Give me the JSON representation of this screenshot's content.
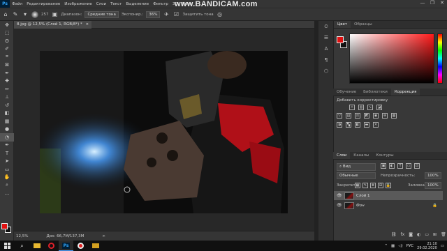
{
  "menubar": {
    "app_icon": "Ps",
    "items": [
      "Файл",
      "Редактирование",
      "Изображение",
      "Слои",
      "Текст",
      "Выделение",
      "Фильтр",
      "3D",
      "Прос"
    ]
  },
  "watermark": "www.BANDICAM.com",
  "window_controls": [
    "—",
    "❐",
    "✕"
  ],
  "options": {
    "brush_size": "257",
    "range_label": "Диапазон:",
    "range_value": "Средние тона",
    "exposure_label": "Экспонир.:",
    "exposure_value": "36%",
    "protect_label": "Защитить тона"
  },
  "document_tab": {
    "title": "8.jpg @ 12,5% (Слой 1, RGB/8*) *",
    "close": "×"
  },
  "statusbar": {
    "zoom": "12,5%",
    "doc": "Док: 66,7М/137,3М",
    "arrow": ">"
  },
  "color_panel": {
    "tabs": [
      "Цвет",
      "Образцы"
    ],
    "fg": "#e01010",
    "bg": "#111111"
  },
  "learn_panel": {
    "tabs": [
      "Обучение",
      "Библиотеки",
      "Коррекция"
    ],
    "add_label": "Добавить корректировку",
    "icons_row1": [
      "brightness-icon",
      "levels-icon",
      "curves-icon",
      "exposure-icon"
    ],
    "icons_row2": [
      "vibrance-icon",
      "hue-icon",
      "balance-icon",
      "bw-icon",
      "photofilter-icon",
      "mixer-icon",
      "lookup-icon"
    ],
    "icons_row3": [
      "invert-icon",
      "posterize-icon",
      "threshold-icon",
      "gradientmap-icon",
      "selectivecolor-icon"
    ]
  },
  "layers_panel": {
    "tabs": [
      "Слои",
      "Каналы",
      "Контуры"
    ],
    "filter_value": "Вид",
    "blend_mode": "Обычные",
    "opacity_label": "Непрозрачность:",
    "opacity_value": "100%",
    "lock_label": "Закрепить:",
    "fill_label": "Заливка:",
    "fill_value": "100%",
    "layers": [
      {
        "name": "Слой 1",
        "visible": true,
        "selected": true
      },
      {
        "name": "Фон",
        "visible": true,
        "selected": false
      }
    ]
  },
  "taskbar": {
    "lang": "РУС",
    "time": "21:10",
    "date": "29.02.2020",
    "ps_label": "Ps"
  }
}
